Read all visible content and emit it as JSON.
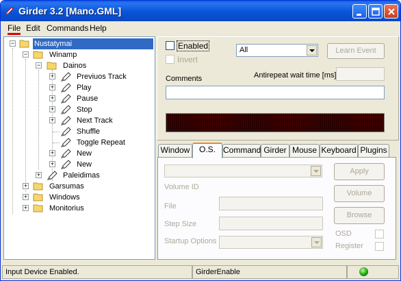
{
  "window": {
    "title": "Girder 3.2 [Mano.GML]"
  },
  "menu": [
    {
      "label": "File"
    },
    {
      "label": "Edit"
    },
    {
      "label": "Commands"
    },
    {
      "label": "Help"
    }
  ],
  "tree": {
    "items": [
      {
        "label": "Nustatymai"
      },
      {
        "label": "Winamp"
      },
      {
        "label": "Dainos"
      },
      {
        "label": "Previuos Track"
      },
      {
        "label": "Play"
      },
      {
        "label": "Pause"
      },
      {
        "label": "Stop"
      },
      {
        "label": "Next Track"
      },
      {
        "label": "Shuffle"
      },
      {
        "label": "Toggle Repeat"
      },
      {
        "label": "New"
      },
      {
        "label": "New"
      },
      {
        "label": "Paleidimas"
      },
      {
        "label": "Garsumas"
      },
      {
        "label": "Windows"
      },
      {
        "label": "Monitorius"
      }
    ]
  },
  "event": {
    "enabled_label": "Enabled",
    "invert_label": "Invert",
    "device_value": "All",
    "learn_label": "Learn Event",
    "antirepeat_label": "Antirepeat wait time [ms]",
    "antirepeat_value": "",
    "comments_label": "Comments",
    "comments_value": ""
  },
  "tabs": [
    {
      "label": "Window"
    },
    {
      "label": "O.S."
    },
    {
      "label": "Command"
    },
    {
      "label": "Girder"
    },
    {
      "label": "Mouse"
    },
    {
      "label": "Keyboard"
    },
    {
      "label": "Plugins"
    }
  ],
  "os_tab": {
    "command_value": "",
    "apply_label": "Apply",
    "volume_id_label": "Volume ID",
    "volume_label": "Volume",
    "file_label": "File",
    "file_value": "",
    "browse_label": "Browse",
    "step_size_label": "Step Size",
    "step_size_value": "",
    "startup_label": "Startup Options",
    "startup_value": "",
    "osd_label": "OSD",
    "register_label": "Register"
  },
  "status": {
    "left": "Input Device Enabled.",
    "middle": "GirderEnable",
    "indicator_color": "#1ea00c"
  },
  "colors": {
    "titlebar": "#0854d8",
    "selection": "#316ac5",
    "tab_accent": "#e68b2c"
  }
}
